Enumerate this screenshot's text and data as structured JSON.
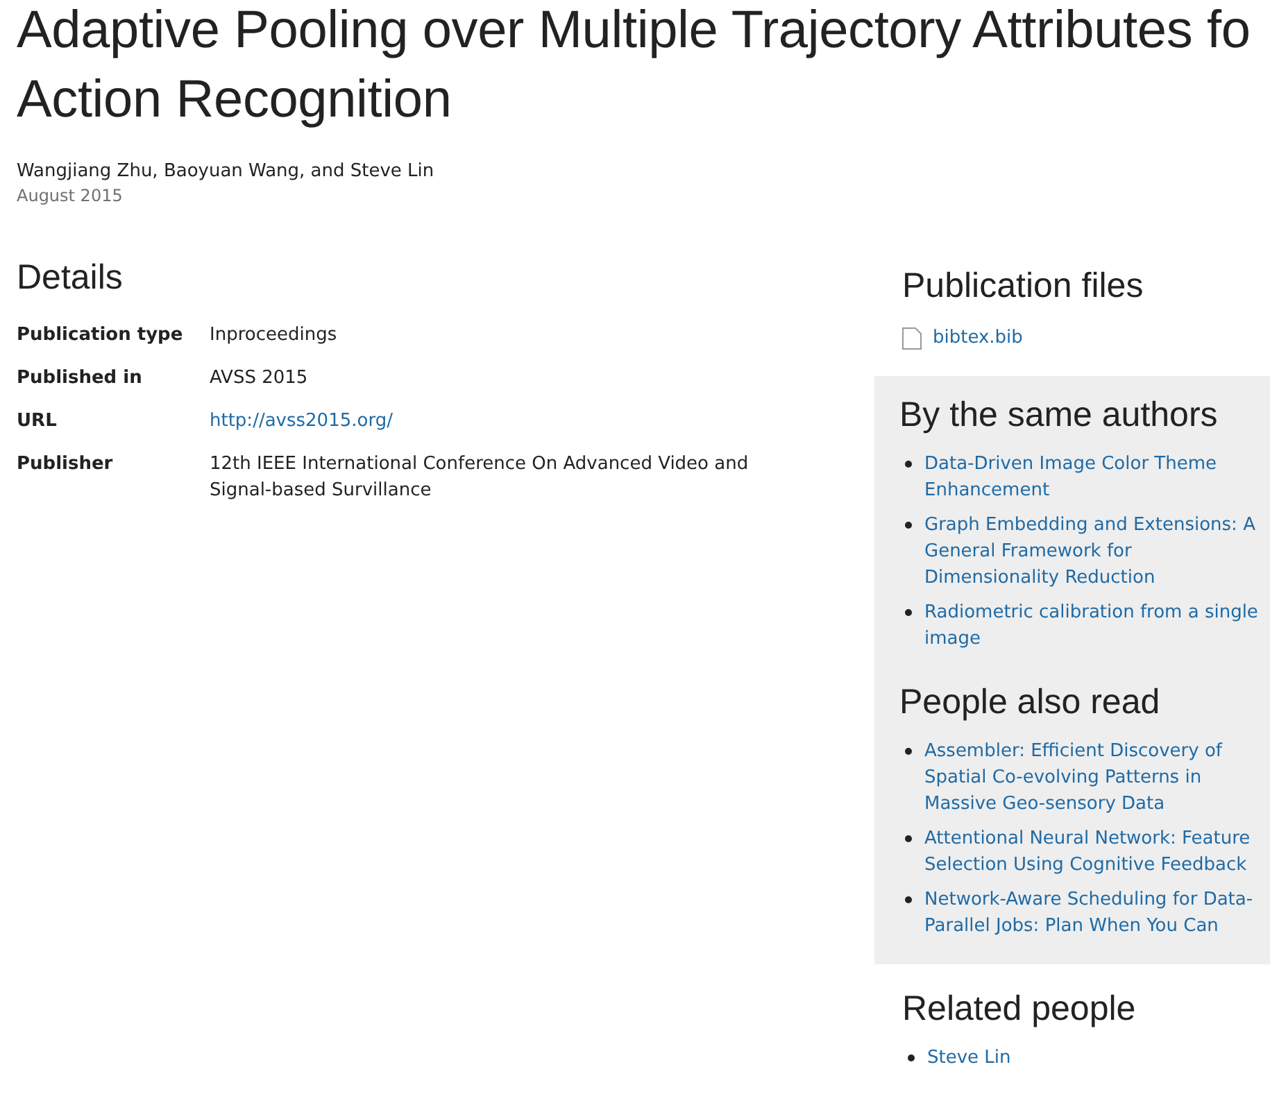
{
  "title_lines": [
    "Adaptive Pooling over Multiple Trajectory Attributes fo",
    "Action Recognition"
  ],
  "authors": "Wangjiang Zhu, Baoyuan Wang, and Steve Lin",
  "date": "August 2015",
  "details": {
    "heading": "Details",
    "rows": [
      {
        "label": "Publication type",
        "value": "Inproceedings",
        "kind": "text"
      },
      {
        "label": "Published in",
        "value": "AVSS 2015",
        "kind": "text"
      },
      {
        "label": "URL",
        "value": "http://avss2015.org/",
        "kind": "link"
      },
      {
        "label": "Publisher",
        "value": "12th IEEE International Conference On Advanced Video and Signal-based Survillance",
        "kind": "text"
      }
    ]
  },
  "publication_files": {
    "heading": "Publication files",
    "files": [
      "bibtex.bib"
    ]
  },
  "same_authors": {
    "heading": "By the same authors",
    "items": [
      "Data-Driven Image Color Theme Enhancement",
      "Graph Embedding and Extensions: A General Framework for Dimensionality Reduction",
      "Radiometric calibration from a single image"
    ]
  },
  "also_read": {
    "heading": "People also read",
    "items": [
      "Assembler: Efficient Discovery of Spatial Co-evolving Patterns in Massive Geo-sensory Data",
      "Attentional Neural Network: Feature Selection Using Cognitive Feedback",
      "Network-Aware Scheduling for Data-Parallel Jobs: Plan When You Can"
    ]
  },
  "related_people": {
    "heading": "Related people",
    "items": [
      "Steve Lin"
    ]
  }
}
